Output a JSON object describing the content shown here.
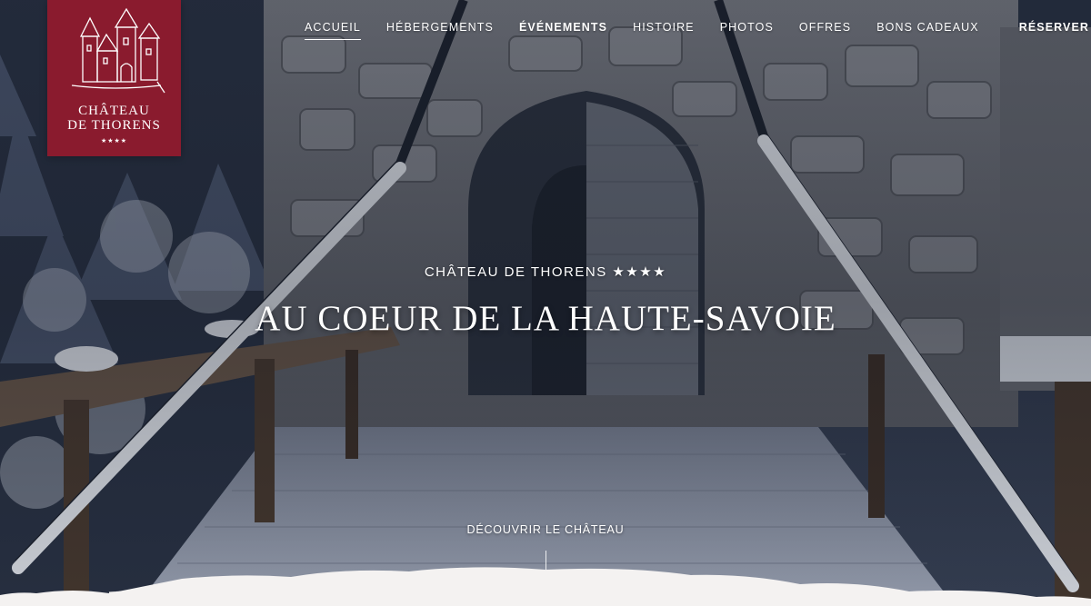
{
  "logo": {
    "line1": "CHÂTEAU",
    "line2": "DE THORENS",
    "stars": "★★★★"
  },
  "nav": {
    "items": [
      {
        "label": "ACCUEIL"
      },
      {
        "label": "HÉBERGEMENTS"
      },
      {
        "label": "ÉVÉNEMENTS"
      },
      {
        "label": "HISTOIRE"
      },
      {
        "label": "PHOTOS"
      },
      {
        "label": "OFFRES"
      },
      {
        "label": "BONS CADEAUX"
      }
    ],
    "reserve": "RÉSERVER"
  },
  "hero": {
    "subtitle": "CHÂTEAU DE THORENS ★★★★",
    "title": "AU COEUR DE LA HAUTE-SAVOIE",
    "discover": "DÉCOUVRIR LE CHÂTEAU"
  },
  "colors": {
    "brand": "#8a1b2e",
    "text": "#ffffff"
  }
}
